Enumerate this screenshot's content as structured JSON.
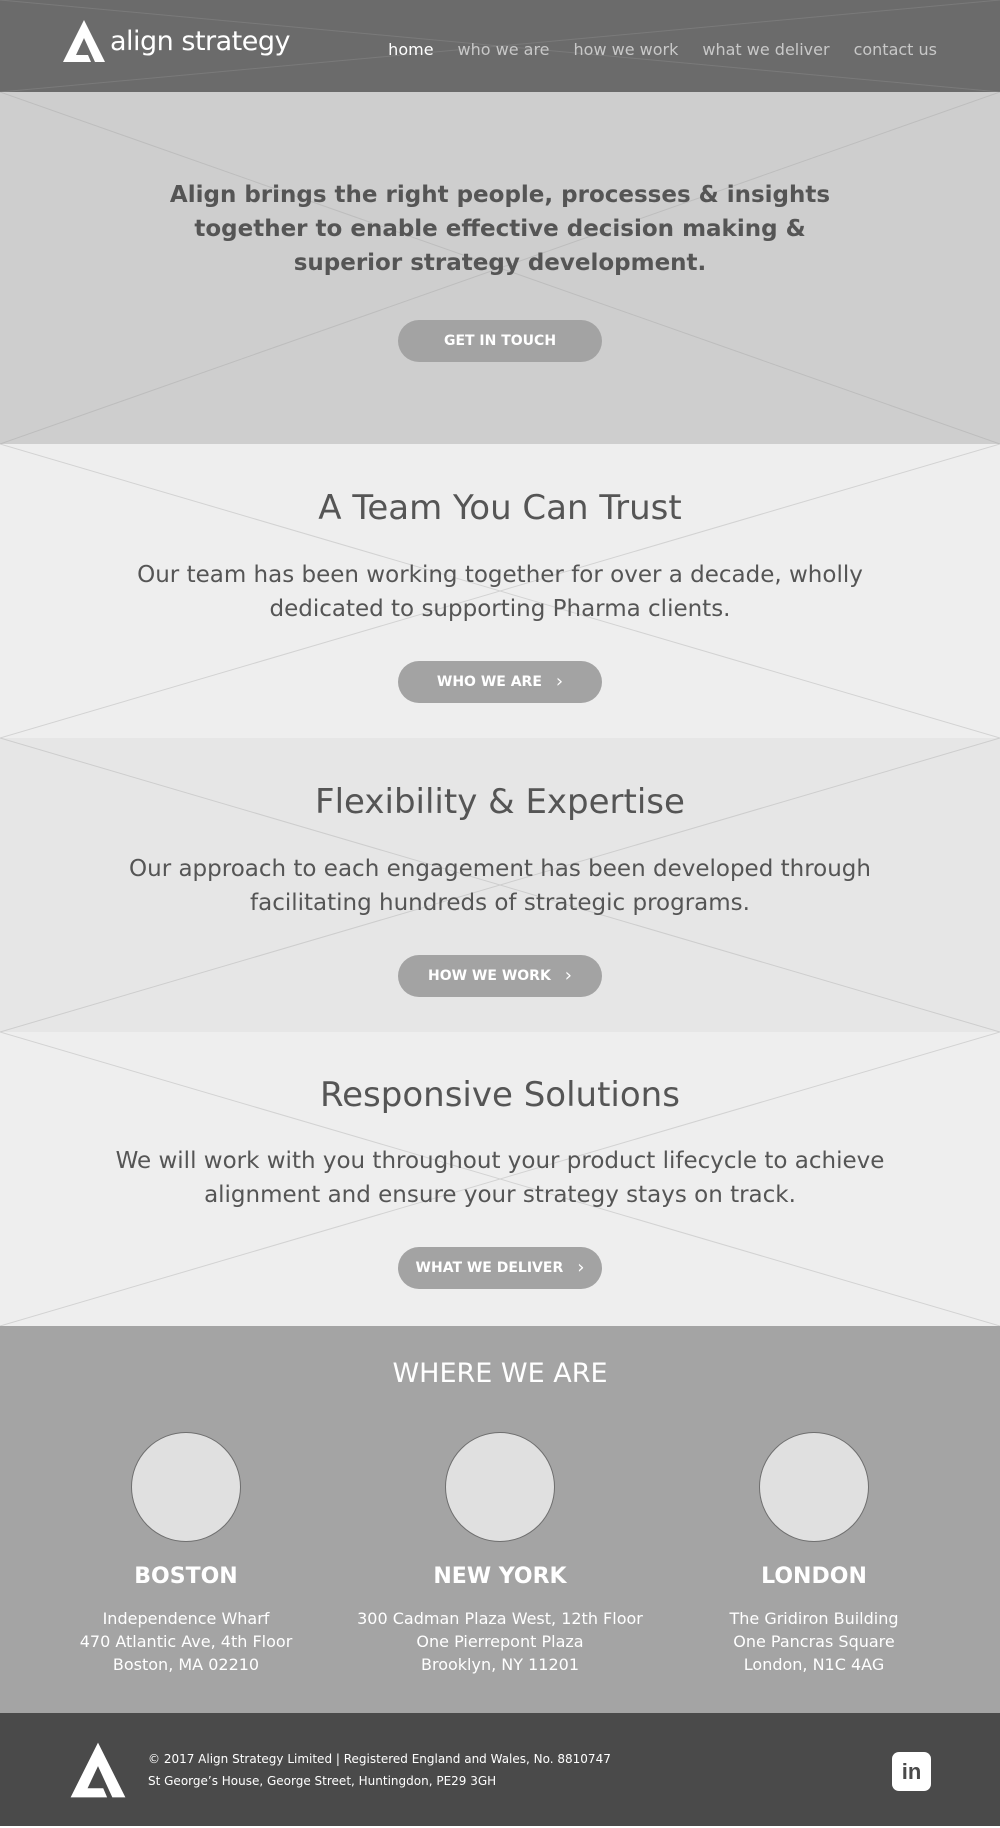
{
  "brand": {
    "name": "align strategy"
  },
  "nav": {
    "items": [
      {
        "label": "home",
        "active": true
      },
      {
        "label": "who we are",
        "active": false
      },
      {
        "label": "how we work",
        "active": false
      },
      {
        "label": "what we deliver",
        "active": false
      },
      {
        "label": "contact us",
        "active": false
      }
    ]
  },
  "hero": {
    "text": "Align brings the right people, processes & insights together to enable effective decision making & superior strategy development.",
    "button_label": "GET IN TOUCH"
  },
  "sections": [
    {
      "title": "A Team You Can Trust",
      "body": "Our team has been working together for over a decade, wholly dedicated to supporting Pharma clients.",
      "button_label": "WHO WE ARE"
    },
    {
      "title": "Flexibility & Expertise",
      "body": "Our approach to each engagement has been developed through facilitating hundreds of strategic programs.",
      "button_label": "HOW WE WORK"
    },
    {
      "title": "Responsive Solutions",
      "body": "We will work with you throughout your product lifecycle to achieve alignment and ensure your strategy stays on track.",
      "button_label": "WHAT WE DELIVER"
    }
  ],
  "where": {
    "title": "WHERE WE ARE",
    "locations": [
      {
        "city": "BOSTON",
        "lines": [
          "Independence Wharf",
          "470 Atlantic Ave, 4th Floor",
          "Boston, MA 02210"
        ]
      },
      {
        "city": "NEW YORK",
        "lines": [
          "300 Cadman Plaza West, 12th Floor",
          "One Pierrepont Plaza",
          "Brooklyn, NY 11201"
        ]
      },
      {
        "city": "LONDON",
        "lines": [
          "The Gridiron Building",
          "One Pancras Square",
          "London, N1C 4AG"
        ]
      }
    ]
  },
  "footer": {
    "line1": "© 2017 Align Strategy Limited | Registered England and Wales, No. 8810747",
    "line2": "St George’s House, George Street, Huntingdon, PE29 3GH",
    "social_icon": "linkedin-icon",
    "linkedin_glyph": "in"
  },
  "colors": {
    "header_bg": "#6b6b6b",
    "hero_bg": "#cecece",
    "section_light": "#eeeeee",
    "section_mid": "#e6e6e6",
    "where_bg": "#a4a4a4",
    "footer_bg": "#4a4a4a",
    "button_bg": "#a3a3a3"
  }
}
